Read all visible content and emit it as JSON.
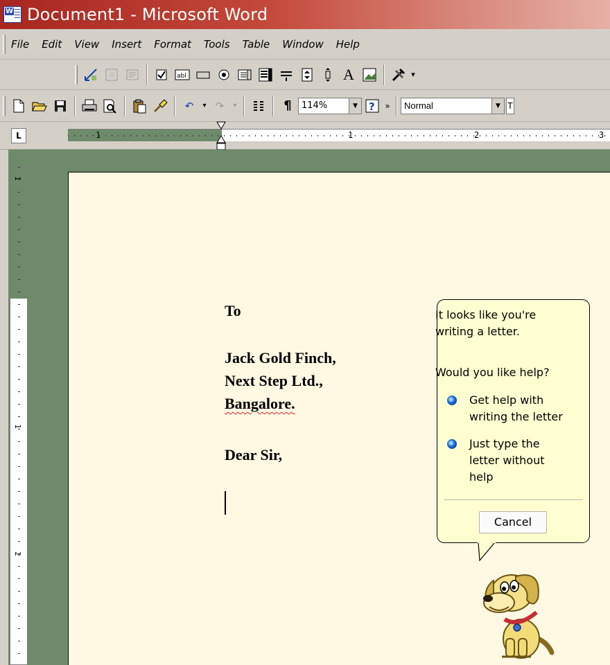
{
  "window": {
    "title": "Document1 - Microsoft Word"
  },
  "menubar": {
    "items": [
      "File",
      "Edit",
      "View",
      "Insert",
      "Format",
      "Tools",
      "Table",
      "Window",
      "Help"
    ]
  },
  "toolbar": {
    "zoom": "114%",
    "style": "Normal",
    "style_cut": "T"
  },
  "ruler": {
    "h_numbers": [
      "1",
      "1",
      "2",
      "3"
    ],
    "v_numbers": [
      "1",
      "1",
      "2"
    ]
  },
  "letter": {
    "greeting_to": "To",
    "recipient_name": "Jack Gold Finch,",
    "company": "Next Step Ltd.,",
    "city": "Bangalore.",
    "salutation": "Dear Sir,"
  },
  "assistant": {
    "message_line1": "It looks like you're",
    "message_line2": "writing a letter.",
    "question": "Would you like help?",
    "option1_line1": "Get help with",
    "option1_line2": "writing the letter",
    "option2_line1": "Just type the",
    "option2_line2": "letter without",
    "option2_line3": "help",
    "cancel_label": "Cancel"
  }
}
